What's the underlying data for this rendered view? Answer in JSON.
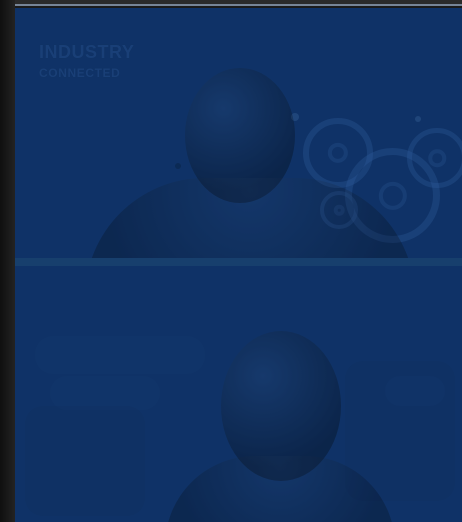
{
  "window": {
    "title": ""
  },
  "tiles": [
    {
      "name": "participant-tile-top",
      "logo": {
        "line1": "INDUSTRY",
        "line2": "CONNECTED"
      }
    },
    {
      "name": "participant-tile-bottom"
    }
  ],
  "colors": {
    "background": "#1b1b1b",
    "tile_blue": "#1d4f86",
    "divider": "#173f6d",
    "top_line": "#7f8fa3"
  },
  "icons": {
    "gear": "gear-icon"
  }
}
